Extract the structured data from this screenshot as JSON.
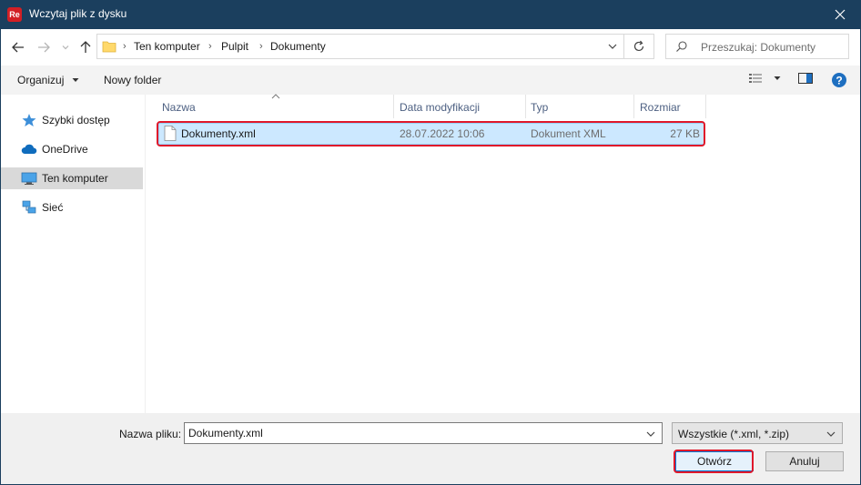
{
  "window": {
    "app_icon_text": "Re",
    "title": "Wczytaj plik z dysku"
  },
  "address": {
    "breadcrumbs": [
      "Ten komputer",
      "Pulpit",
      "Dokumenty"
    ]
  },
  "search": {
    "placeholder": "Przeszukaj: Dokumenty"
  },
  "toolbar": {
    "organize_label": "Organizuj",
    "new_folder_label": "Nowy folder"
  },
  "sidebar": {
    "items": [
      {
        "label": "Szybki dostęp",
        "icon": "star-icon"
      },
      {
        "label": "OneDrive",
        "icon": "cloud-icon"
      },
      {
        "label": "Ten komputer",
        "icon": "computer-icon",
        "selected": true
      },
      {
        "label": "Sieć",
        "icon": "network-icon"
      }
    ]
  },
  "columns": {
    "name": "Nazwa",
    "modified": "Data modyfikacji",
    "type": "Typ",
    "size": "Rozmiar"
  },
  "files": [
    {
      "name": "Dokumenty.xml",
      "modified": "28.07.2022 10:06",
      "type": "Dokument XML",
      "size": "27 KB",
      "selected": true
    }
  ],
  "footer": {
    "filename_label": "Nazwa pliku:",
    "filename_value": "Dokumenty.xml",
    "filter_value": "Wszystkie (*.xml, *.zip)",
    "open_label": "Otwórz",
    "cancel_label": "Anuluj"
  },
  "colors": {
    "titlebar": "#1b3f5e",
    "selection": "#cce8ff",
    "highlight_outline": "#e0182a",
    "app_icon": "#d21f25"
  }
}
